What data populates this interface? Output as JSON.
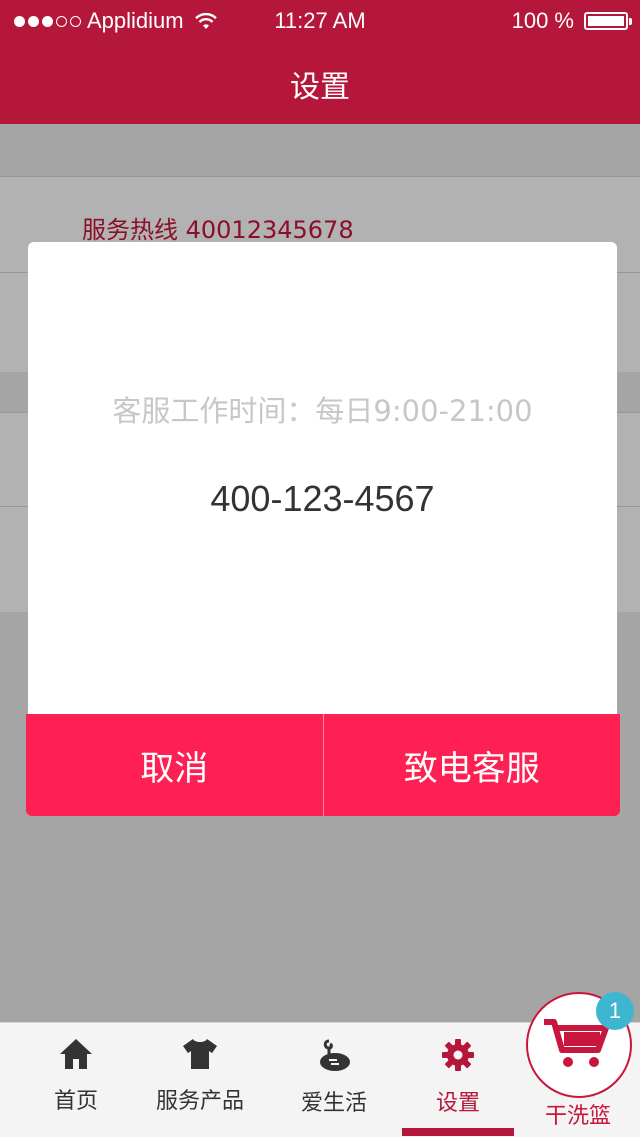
{
  "status_bar": {
    "carrier": "Applidium",
    "time": "11:27  AM",
    "battery": "100  %"
  },
  "header": {
    "title": "设置"
  },
  "settings": {
    "hotline": "服务热线 40012345678"
  },
  "dialog": {
    "hours": "客服工作时间：每日9:00-21:00",
    "phone": "400-123-4567",
    "cancel_label": "取消",
    "call_label": "致电客服"
  },
  "tabs": [
    {
      "label": "首页",
      "icon": "home-icon"
    },
    {
      "label": "服务产品",
      "icon": "shirt-icon"
    },
    {
      "label": "爱生活",
      "icon": "life-icon"
    },
    {
      "label": "设置",
      "icon": "gear-icon",
      "active": true
    }
  ],
  "cart": {
    "label": "干洗篮",
    "badge": "1",
    "icon": "cart-icon"
  },
  "colors": {
    "brand": "#b5173b",
    "button": "#fe2052",
    "badge": "#3eb6cf"
  }
}
